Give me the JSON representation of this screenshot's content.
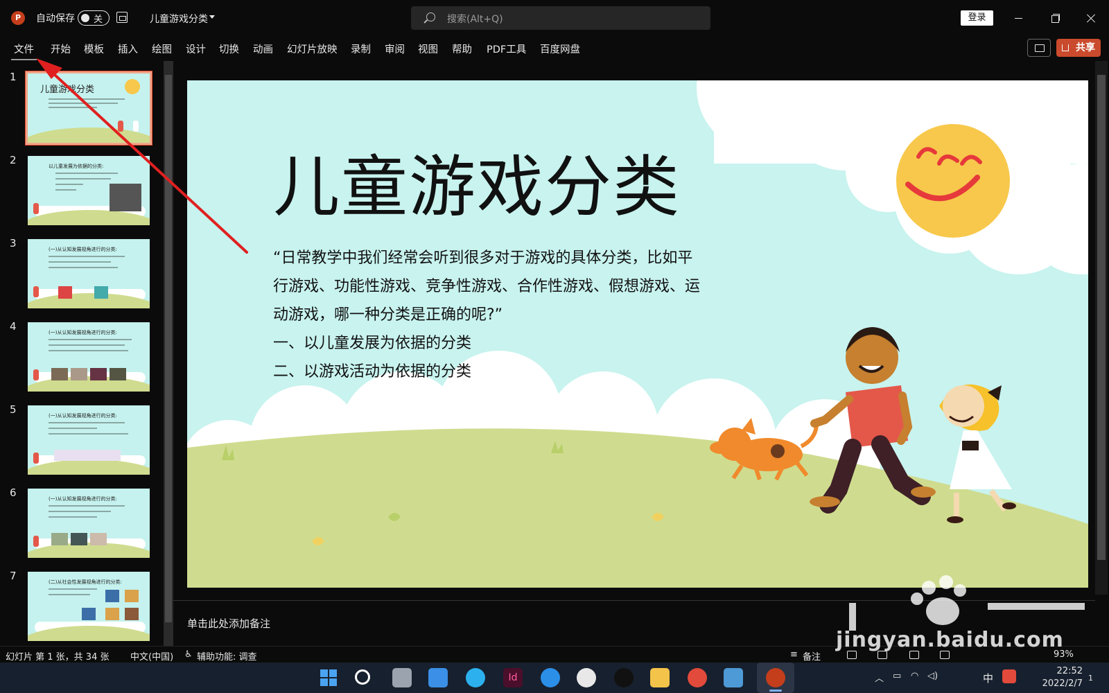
{
  "titlebar": {
    "autosave_label": "自动保存",
    "autosave_state": "关",
    "doc_title": "儿童游戏分类",
    "search_placeholder": "搜索(Alt+Q)",
    "login_label": "登录"
  },
  "ribbon": {
    "tabs": [
      "文件",
      "开始",
      "模板",
      "插入",
      "绘图",
      "设计",
      "切换",
      "动画",
      "幻灯片放映",
      "录制",
      "审阅",
      "视图",
      "帮助",
      "PDF工具",
      "百度网盘"
    ],
    "share_label": "共享"
  },
  "thumbnails": {
    "numbers": [
      "1",
      "2",
      "3",
      "4",
      "5",
      "6",
      "7"
    ],
    "titles": [
      "儿童游戏分类",
      "以儿童发展为依据的分类:",
      "(一)从认知发展视角进行的分类:",
      "(一)从认知发展视角进行的分类:",
      "(一)从认知发展视角进行的分类:",
      "(一)从认知发展视角进行的分类:",
      "(二)从社会性发展视角进行的分类:"
    ]
  },
  "slide": {
    "title": "儿童游戏分类",
    "body": [
      "“日常教学中我们经常会听到很多对于游戏的具体分类，比如平行游戏、功能性游戏、竞争性游戏、合作性游戏、假想游戏、运动游戏，哪一种分类是正确的呢?”",
      "一、以儿童发展为依据的分类",
      "二、以游戏活动为依据的分类"
    ]
  },
  "notes": {
    "placeholder": "单击此处添加备注"
  },
  "statusbar": {
    "slide_info": "幻灯片 第 1 张，共 34 张",
    "language": "中文(中国)",
    "accessibility": "辅助功能: 调查",
    "notes_label": "备注",
    "zoom": "93%"
  },
  "taskbar": {
    "ime": "中",
    "time": "22:52",
    "date": "2022/2/7",
    "notification_count": "1"
  },
  "watermark": {
    "text": "jingyan.baidu.com"
  },
  "colors": {
    "accent": "#c43e1c",
    "share": "#c94a2c",
    "slide_bg": "#c8f3ef",
    "arrow": "#e02020"
  }
}
